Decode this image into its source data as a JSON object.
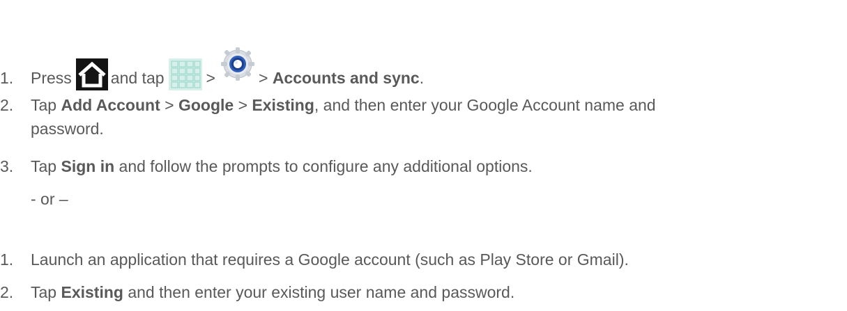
{
  "first_method": {
    "step1": {
      "num": "1.",
      "t1": "Press",
      "t2": "and tap",
      "sep1": ">",
      "sep2": ">",
      "bold": "Accounts and sync",
      "end": ".",
      "icons": [
        "home-icon",
        "apps-grid-icon",
        "settings-gear-icon"
      ]
    },
    "step2": {
      "num": "2.",
      "t1": "Tap",
      "b1": "Add Account",
      "sep1": ">",
      "b2": "Google",
      "sep2": ">",
      "b3": "Existing",
      "t2": ", and then enter your Google Account name and",
      "line2": "password."
    },
    "step3": {
      "num": "3.",
      "t1": "Tap",
      "b1": "Sign in",
      "t2": "and follow the prompts to configure any additional options."
    }
  },
  "separator": "- or –",
  "second_method": {
    "step1": {
      "num": "1.",
      "text": "Launch an application that requires a Google account (such as Play Store or Gmail)."
    },
    "step2": {
      "num": "2.",
      "t1": "Tap",
      "b1": "Existing",
      "t2": "and then enter your existing user name and password."
    }
  },
  "colors": {
    "text": "#595959",
    "home_icon_bg": "#141414",
    "grid_icon": "#c8ece4",
    "gear_icon": "#2f5fb8"
  }
}
